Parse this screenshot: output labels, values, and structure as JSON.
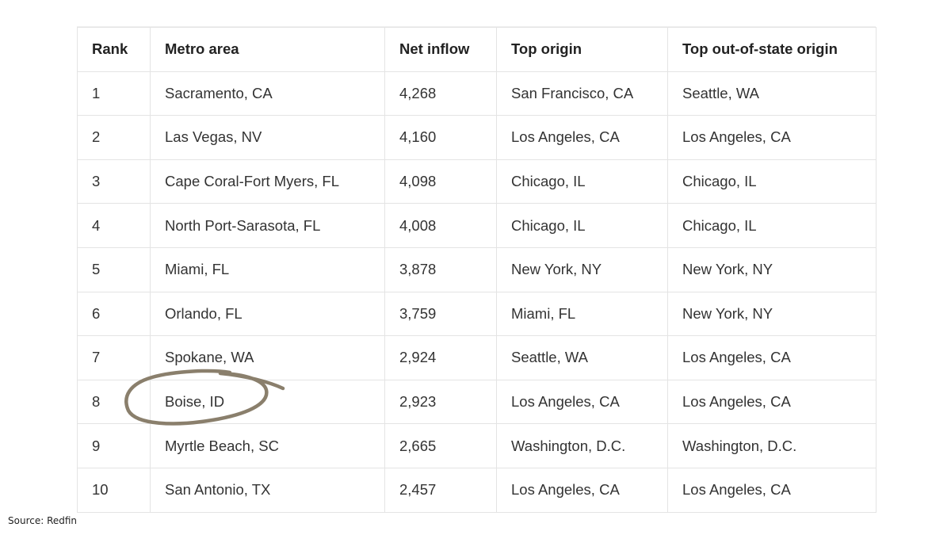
{
  "table": {
    "headers": [
      "Rank",
      "Metro area",
      "Net inflow",
      "Top origin",
      "Top out-of-state origin"
    ],
    "rows": [
      [
        "1",
        "Sacramento, CA",
        "4,268",
        "San Francisco, CA",
        "Seattle, WA"
      ],
      [
        "2",
        "Las Vegas, NV",
        "4,160",
        "Los Angeles, CA",
        "Los Angeles, CA"
      ],
      [
        "3",
        "Cape Coral-Fort Myers, FL",
        "4,098",
        "Chicago, IL",
        "Chicago, IL"
      ],
      [
        "4",
        "North Port-Sarasota, FL",
        "4,008",
        "Chicago, IL",
        "Chicago, IL"
      ],
      [
        "5",
        "Miami, FL",
        "3,878",
        "New York, NY",
        "New York, NY"
      ],
      [
        "6",
        "Orlando, FL",
        "3,759",
        "Miami, FL",
        "New York, NY"
      ],
      [
        "7",
        "Spokane, WA",
        "2,924",
        "Seattle, WA",
        "Los Angeles, CA"
      ],
      [
        "8",
        "Boise, ID",
        "2,923",
        "Los Angeles, CA",
        "Los Angeles, CA"
      ],
      [
        "9",
        "Myrtle Beach, SC",
        "2,665",
        "Washington, D.C.",
        "Washington, D.C."
      ],
      [
        "10",
        "San Antonio, TX",
        "2,457",
        "Los Angeles, CA",
        "Los Angeles, CA"
      ]
    ]
  },
  "annotation": {
    "icon": "hand-drawn-circle-highlight",
    "color": "#8a7f6c",
    "highlighted_row_rank": "8"
  },
  "source": {
    "text": "Source: Redfin"
  }
}
